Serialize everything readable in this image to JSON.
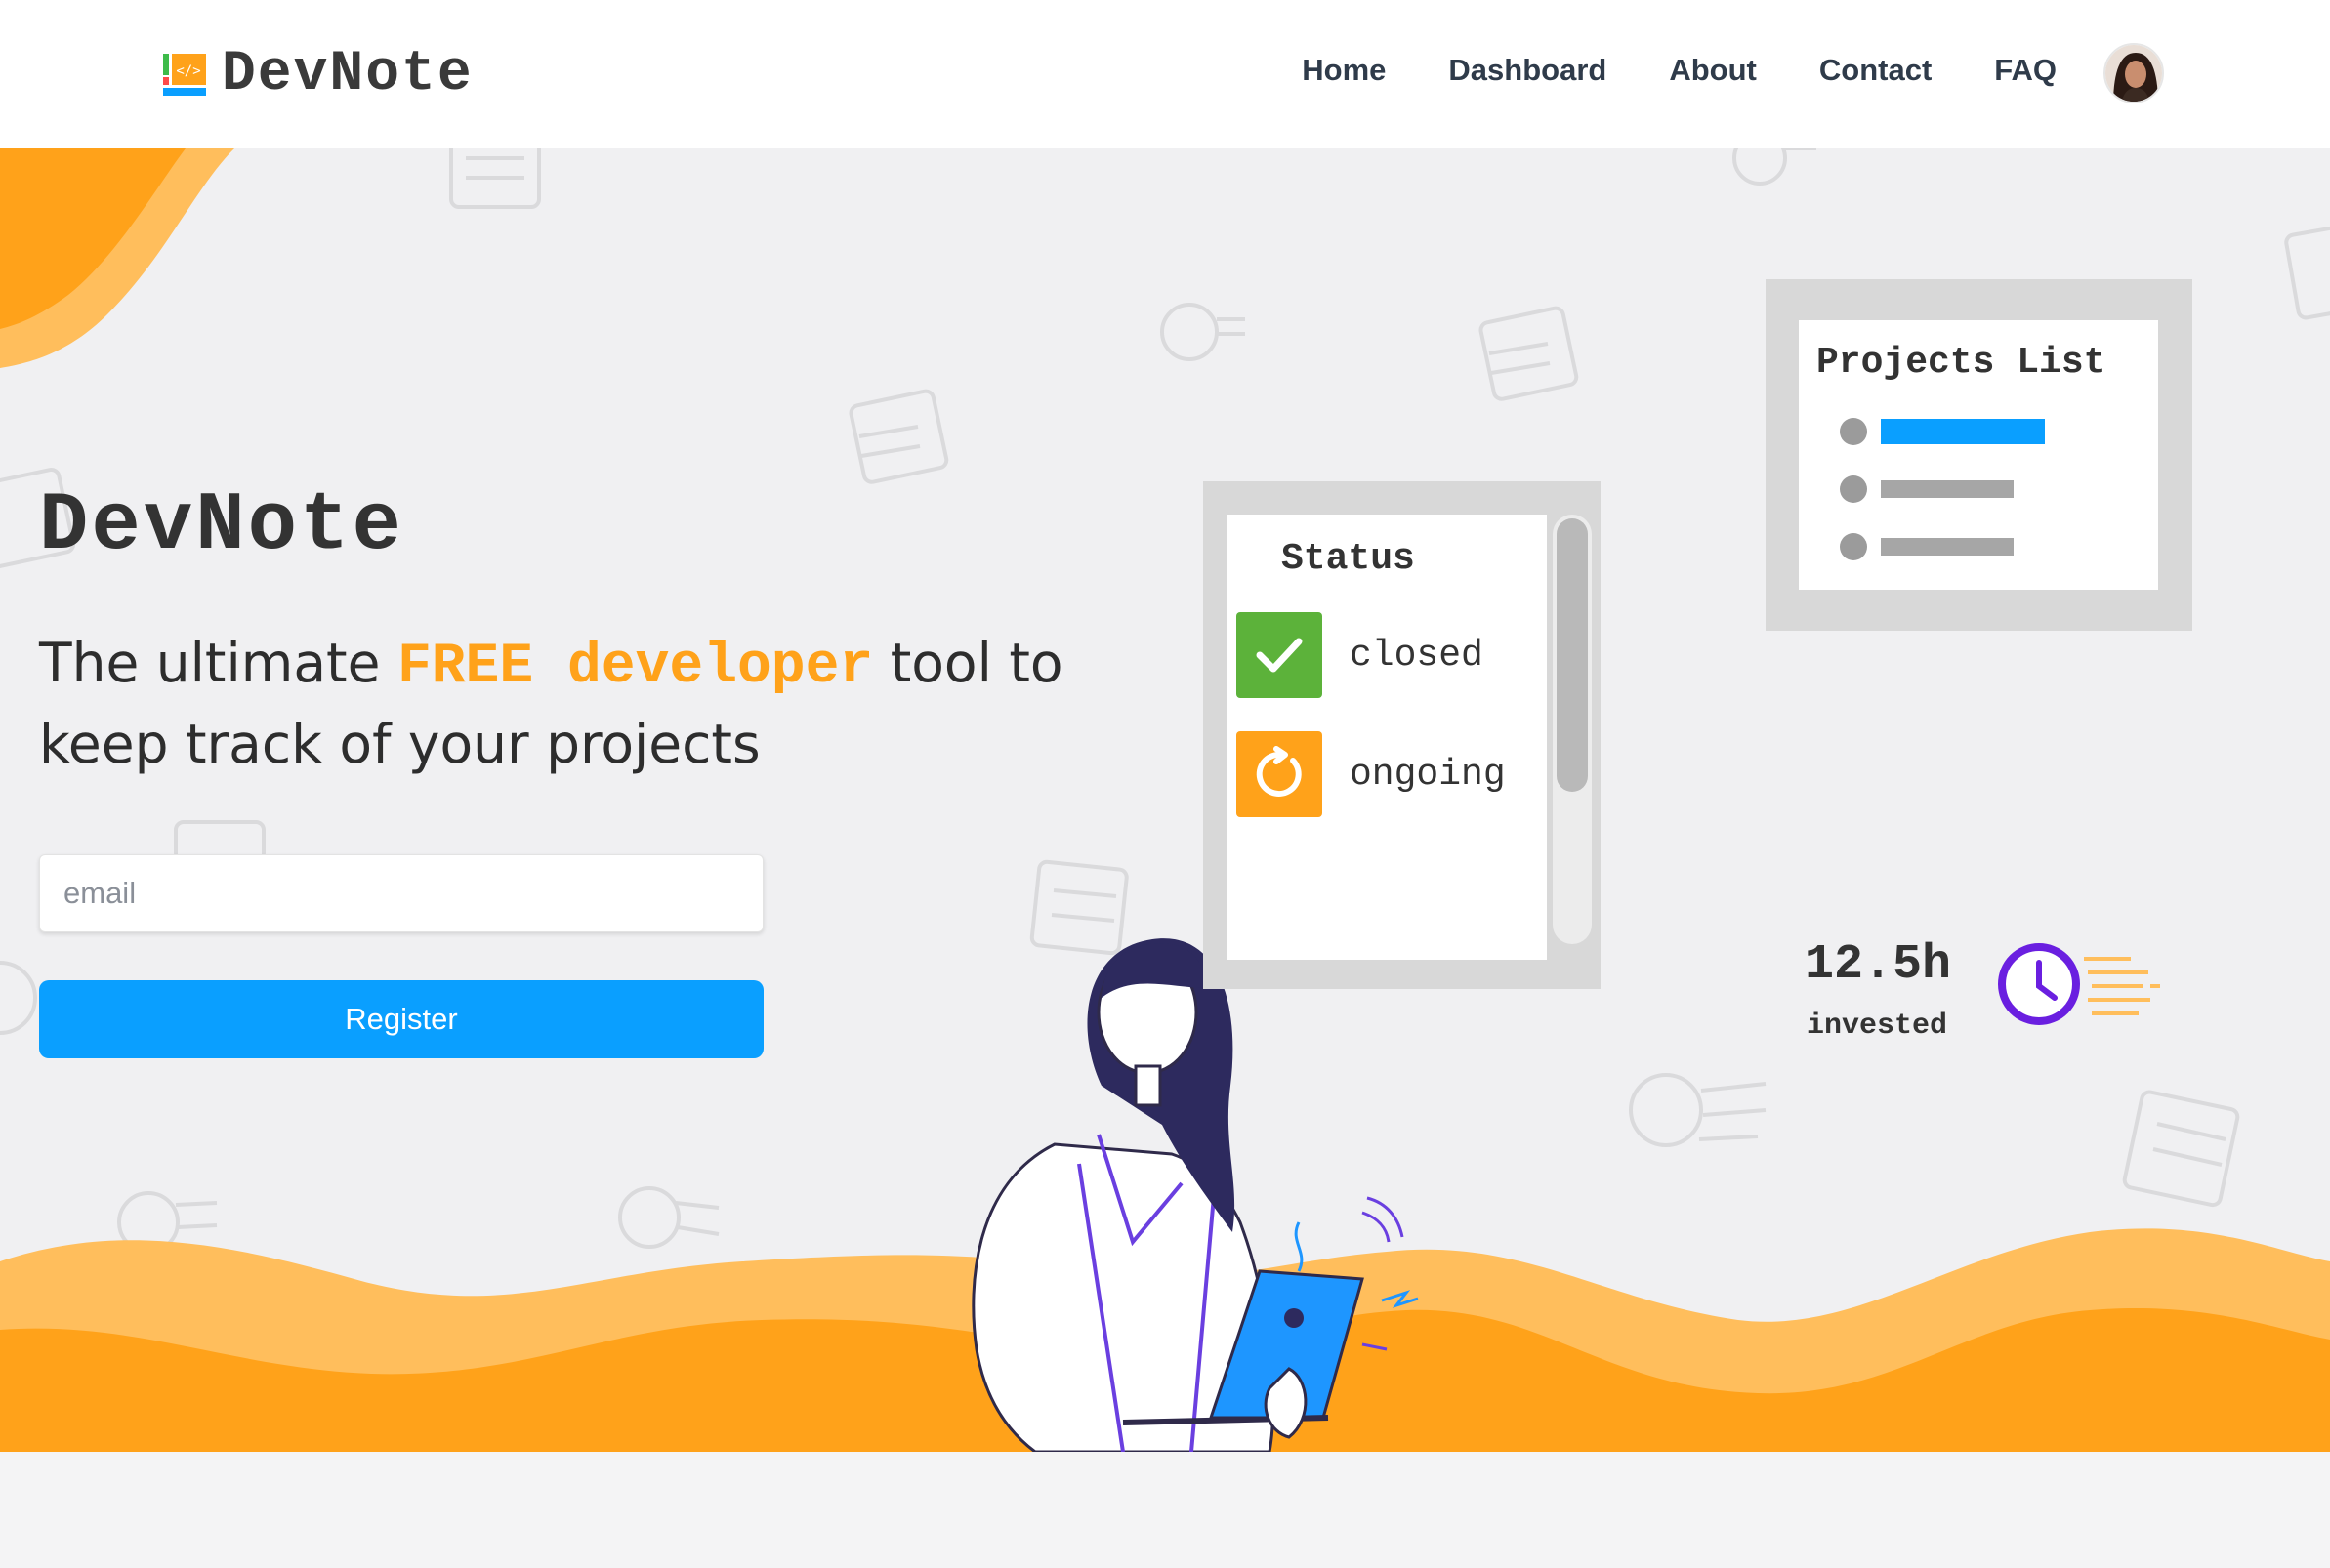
{
  "brand": {
    "name": "DevNote"
  },
  "nav": {
    "items": [
      {
        "label": "Home"
      },
      {
        "label": "Dashboard"
      },
      {
        "label": "About"
      },
      {
        "label": "Contact"
      },
      {
        "label": "FAQ"
      }
    ]
  },
  "hero": {
    "title": "DevNote",
    "subtitle_pre": "The ultimate ",
    "subtitle_highlight": "FREE developer",
    "subtitle_post": " tool to keep track of your projects",
    "email_placeholder": "email",
    "register_label": "Register"
  },
  "status_card": {
    "title": "Status",
    "items": [
      {
        "label": "closed",
        "icon": "check-icon",
        "color": "#5cb23a"
      },
      {
        "label": "ongoing",
        "icon": "refresh-icon",
        "color": "#ffa21a"
      }
    ]
  },
  "projects_card": {
    "title": "Projects List"
  },
  "time": {
    "value": "12.5h",
    "label": "invested"
  },
  "colors": {
    "accent": "#ffa21a",
    "primary": "#0a9fff",
    "clock": "#6a1fe0"
  }
}
